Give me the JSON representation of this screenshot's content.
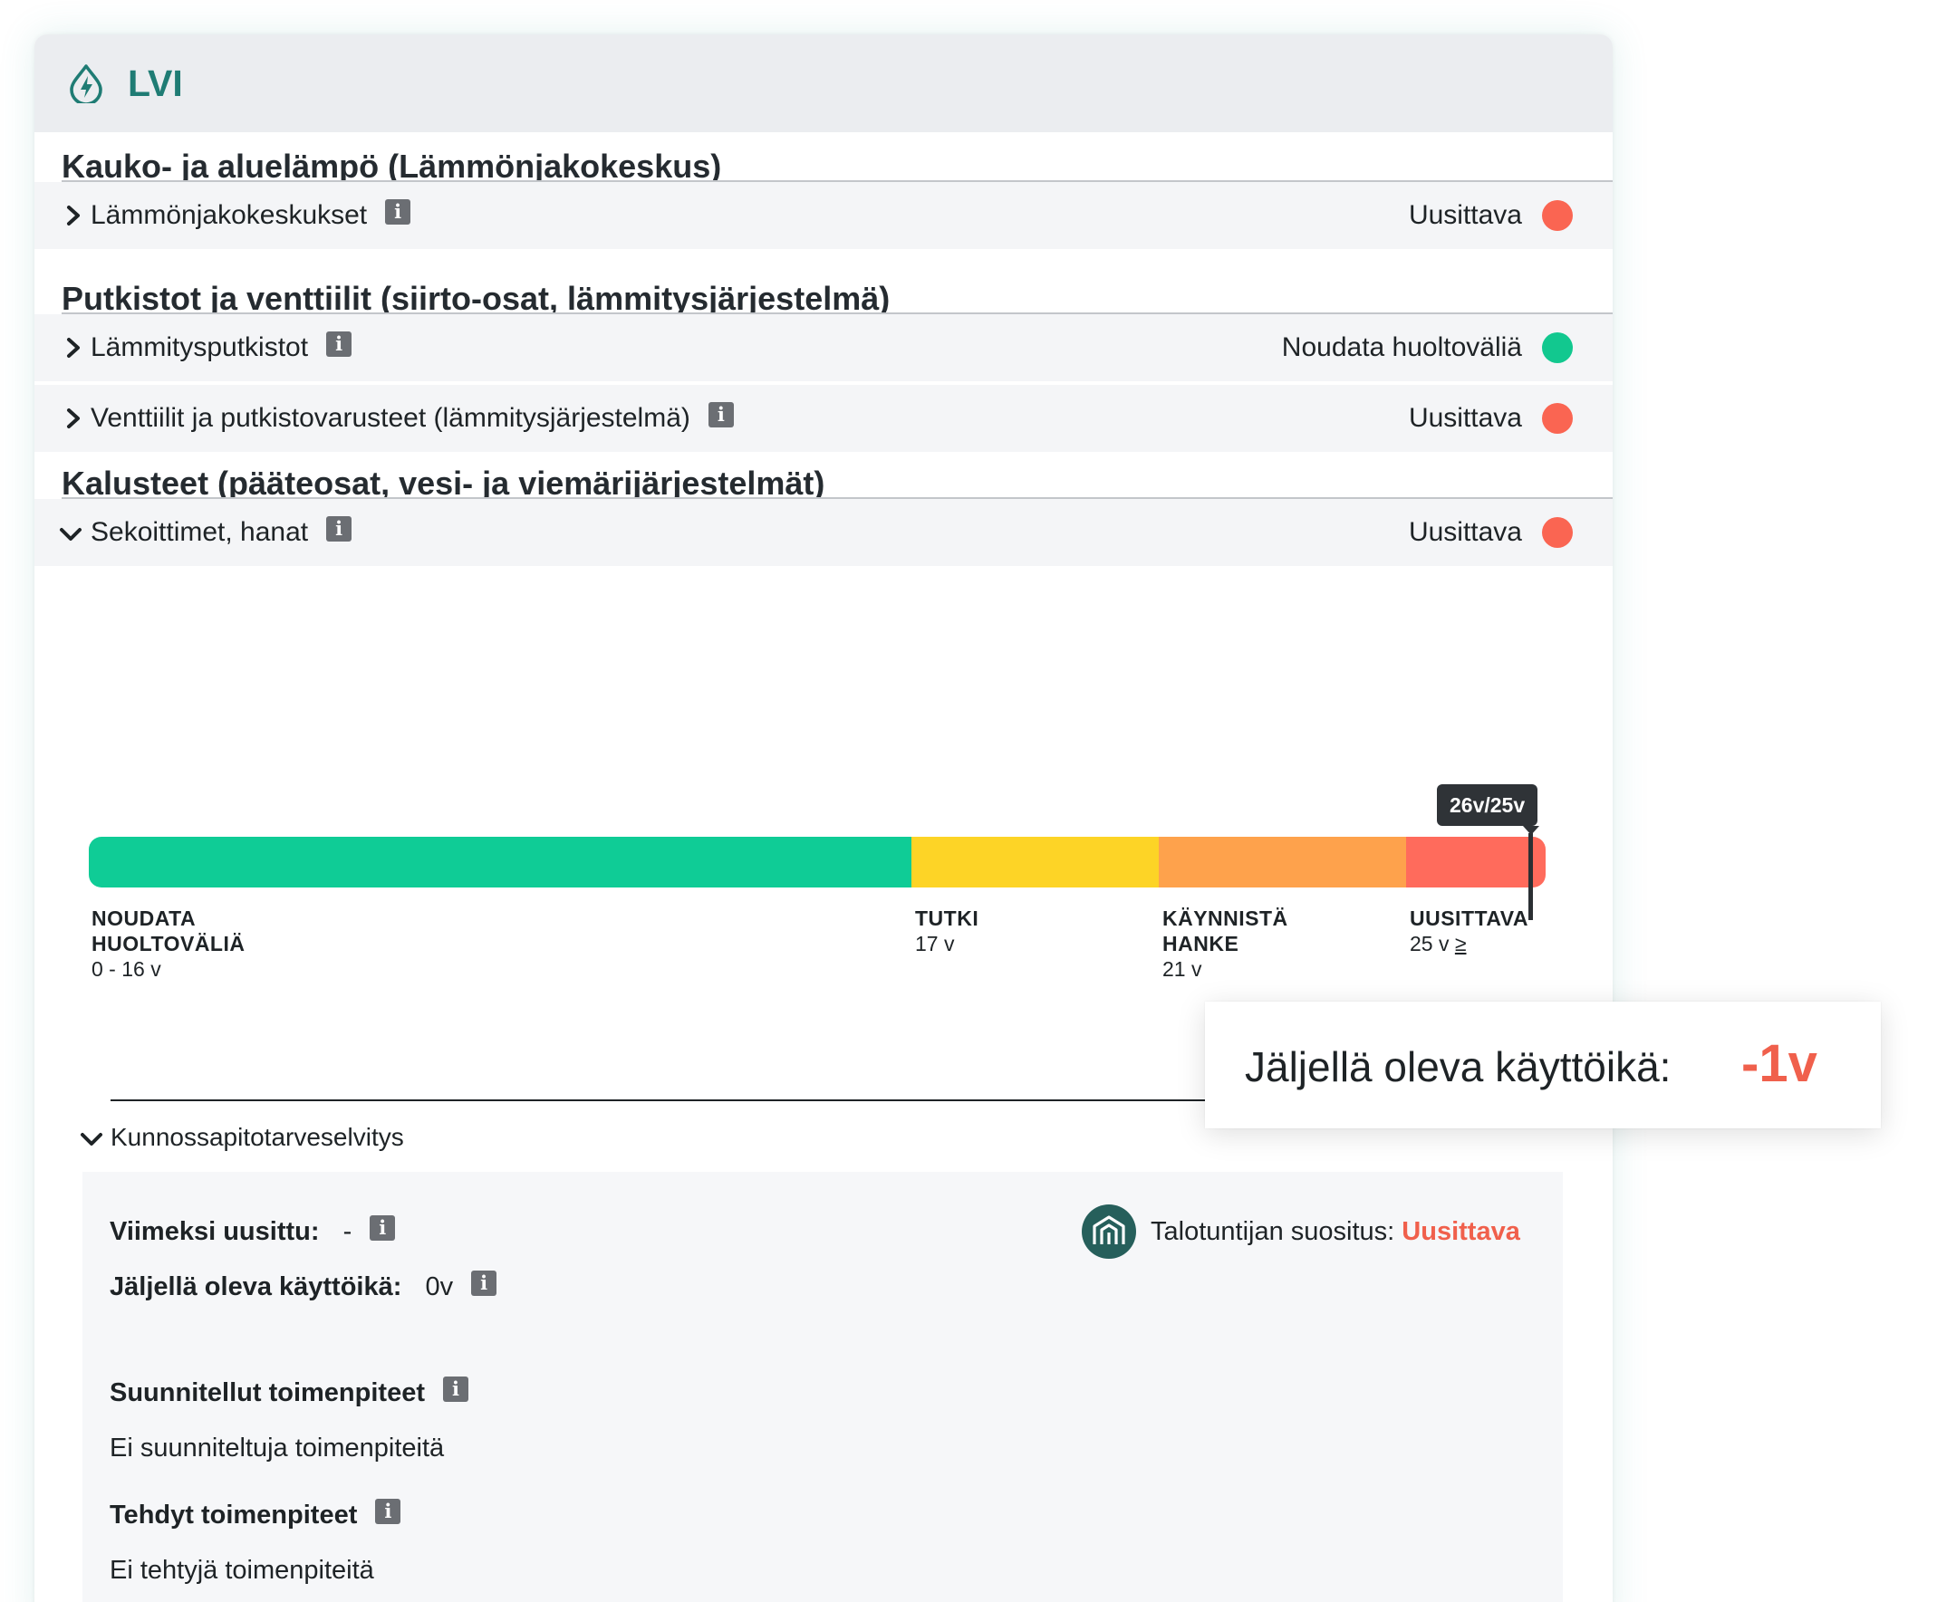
{
  "header": {
    "title": "LVI",
    "icon": "energy-drop-icon"
  },
  "colors": {
    "accent": "#1f7c74",
    "status_red": "#fa6552",
    "status_green": "#12c88f",
    "bar_green": "#0fcc96",
    "bar_yellow": "#fdd426",
    "bar_orange": "#fea24c",
    "bar_red": "#ff6b5c"
  },
  "sections": [
    {
      "title": "Kauko- ja aluelämpö (Lämmönjakokeskus)",
      "rows": [
        {
          "label": "Lämmönjakokeskukset",
          "status": "Uusittava",
          "status_color": "red",
          "expanded": false
        }
      ]
    },
    {
      "title": "Putkistot ja venttiilit (siirto-osat, lämmitysjärjestelmä)",
      "rows": [
        {
          "label": "Lämmitysputkistot",
          "status": "Noudata huoltoväliä",
          "status_color": "green",
          "expanded": false
        },
        {
          "label": "Venttiilit ja putkistovarusteet (lämmitysjärjestelmä)",
          "status": "Uusittava",
          "status_color": "red",
          "expanded": false
        }
      ]
    },
    {
      "title": "Kalusteet (pääteosat, vesi- ja viemärijärjestelmät)",
      "rows": [
        {
          "label": "Sekoittimet, hanat",
          "status": "Uusittava",
          "status_color": "red",
          "expanded": true
        }
      ]
    }
  ],
  "lifecycle": {
    "tooltip": "26v/25v",
    "age_years": 26,
    "lifetime_years": 25,
    "segments": [
      {
        "name_line1": "NOUDATA",
        "name_line2": "HUOLTOVÄLIÄ",
        "range": "0 - 16 v",
        "color": "green"
      },
      {
        "name_line1": "TUTKI",
        "name_line2": "",
        "range": "17 v",
        "color": "yellow"
      },
      {
        "name_line1": "KÄYNNISTÄ",
        "name_line2": "HANKE",
        "range": "21 v",
        "color": "orange"
      },
      {
        "name_line1": "UUSITTAVA",
        "name_line2": "",
        "range": "25 v",
        "range_suffix": "≥",
        "color": "red"
      }
    ]
  },
  "callout": {
    "label": "Jäljellä oleva käyttöikä:",
    "value": "-1v"
  },
  "details": {
    "toggle_label": "Kunnossapitotarveselvitys",
    "last_renewed_label": "Viimeksi uusittu:",
    "last_renewed_value": "-",
    "remaining_label": "Jäljellä oleva käyttöikä:",
    "remaining_value": "0v",
    "recommendation_label": "Talotuntijan suositus:",
    "recommendation_value": "Uusittava",
    "planned_title": "Suunnitellut toimenpiteet",
    "planned_text": "Ei suunniteltuja toimenpiteitä",
    "done_title": "Tehdyt toimenpiteet",
    "done_text": "Ei tehtyjä toimenpiteitä"
  }
}
